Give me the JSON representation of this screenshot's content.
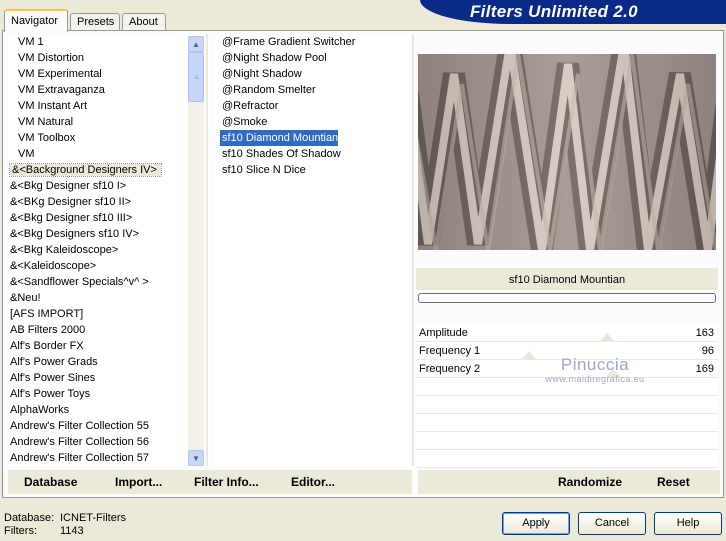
{
  "window": {
    "title": "Filters Unlimited 2.0"
  },
  "tabs": [
    {
      "label": "Navigator",
      "active": true
    },
    {
      "label": "Presets",
      "active": false
    },
    {
      "label": "About",
      "active": false
    }
  ],
  "categories": [
    {
      "label": "VM 1",
      "indent": true
    },
    {
      "label": "VM Distortion",
      "indent": true
    },
    {
      "label": "VM Experimental",
      "indent": true
    },
    {
      "label": "VM Extravaganza",
      "indent": true
    },
    {
      "label": "VM Instant Art",
      "indent": true
    },
    {
      "label": "VM Natural",
      "indent": true
    },
    {
      "label": "VM Toolbox",
      "indent": true
    },
    {
      "label": "VM",
      "indent": true
    },
    {
      "label": "&<Background Designers IV>",
      "indent": false,
      "selected": true
    },
    {
      "label": "&<Bkg Designer sf10 I>",
      "indent": false
    },
    {
      "label": "&<BKg Designer sf10 II>",
      "indent": false
    },
    {
      "label": "&<Bkg Designer sf10 III>",
      "indent": false
    },
    {
      "label": "&<Bkg Designers sf10 IV>",
      "indent": false
    },
    {
      "label": "&<Bkg Kaleidoscope>",
      "indent": false
    },
    {
      "label": "&<Kaleidoscope>",
      "indent": false
    },
    {
      "label": "&<Sandflower Specials^v^ >",
      "indent": false
    },
    {
      "label": "&Neu!",
      "indent": false
    },
    {
      "label": "[AFS IMPORT]",
      "indent": false
    },
    {
      "label": "AB Filters 2000",
      "indent": false
    },
    {
      "label": "Alf's Border FX",
      "indent": false
    },
    {
      "label": "Alf's Power Grads",
      "indent": false
    },
    {
      "label": "Alf's Power Sines",
      "indent": false
    },
    {
      "label": "Alf's Power Toys",
      "indent": false
    },
    {
      "label": "AlphaWorks",
      "indent": false
    },
    {
      "label": "Andrew's Filter Collection 55",
      "indent": false
    },
    {
      "label": "Andrew's Filter Collection 56",
      "indent": false
    },
    {
      "label": "Andrew's Filter Collection 57",
      "indent": false
    }
  ],
  "filters": [
    {
      "label": "@Frame Gradient Switcher"
    },
    {
      "label": "@Night Shadow Pool"
    },
    {
      "label": "@Night Shadow"
    },
    {
      "label": "@Random Smelter"
    },
    {
      "label": "@Refractor"
    },
    {
      "label": "@Smoke"
    },
    {
      "label": "sf10 Diamond Mountian",
      "selected": true
    },
    {
      "label": "sf10 Shades Of Shadow"
    },
    {
      "label": "sf10 Slice N Dice"
    }
  ],
  "preview": {
    "selected_filter": "sf10 Diamond Mountian"
  },
  "parameters": [
    {
      "label": "Amplitude",
      "value": "163"
    },
    {
      "label": "Frequency 1",
      "value": "96"
    },
    {
      "label": "Frequency 2",
      "value": "169"
    }
  ],
  "watermark": {
    "line1": "Pinuccia",
    "line2": "www.maidiregrafica.eu"
  },
  "toolbar": {
    "database": "Database",
    "import": "Import...",
    "filter_info": "Filter Info...",
    "editor": "Editor...",
    "randomize": "Randomize",
    "reset": "Reset"
  },
  "status": {
    "database_label": "Database:",
    "database_value": "ICNET-Filters",
    "filters_label": "Filters:",
    "filters_value": "1143"
  },
  "buttons": {
    "apply": "Apply",
    "cancel": "Cancel",
    "help": "Help"
  }
}
